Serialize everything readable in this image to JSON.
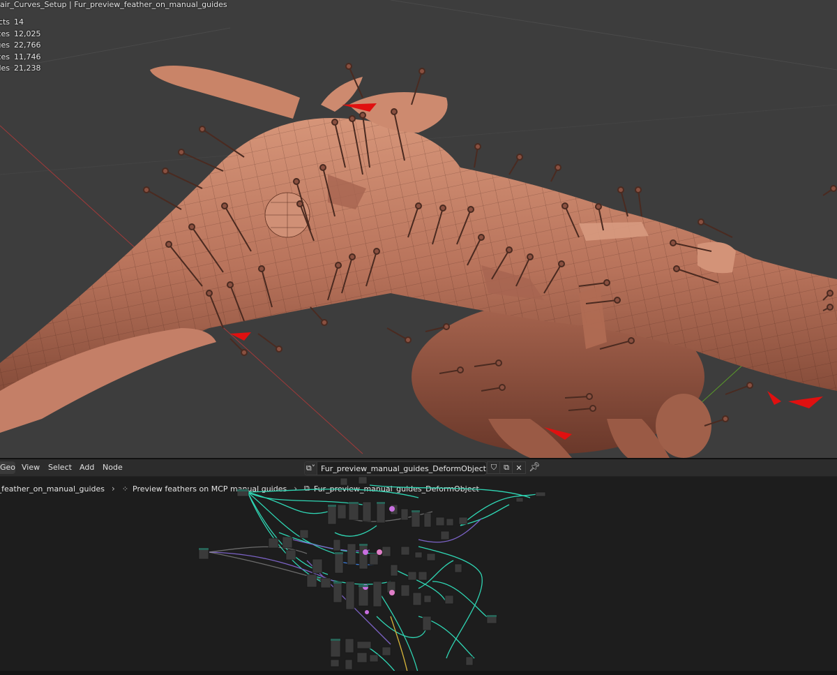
{
  "viewport": {
    "overlay_title": "air_Curves_Setup | Fur_preview_feather_on_manual_guides",
    "stats": [
      {
        "label": "Objects",
        "value": "14"
      },
      {
        "label": "Vertices",
        "value": "12,025"
      },
      {
        "label": "Edges",
        "value": "22,766"
      },
      {
        "label": "Faces",
        "value": "11,746"
      },
      {
        "label": "Triangles",
        "value": "21,238"
      }
    ],
    "colors": {
      "background": "#3d3d3d",
      "mesh": "#c7826a",
      "accent_red": "#e01010"
    }
  },
  "node_editor": {
    "editor_type_label": "Geometry Node Editor",
    "menus": [
      {
        "label": "View"
      },
      {
        "label": "Select"
      },
      {
        "label": "Add"
      },
      {
        "label": "Node"
      }
    ],
    "node_tree_name": "Fur_preview_manual_guides_DeformObject",
    "breadcrumb": [
      {
        "label": "Fur_preview_feather_on_manual_guides",
        "icon": "object-icon"
      },
      {
        "label": "Preview feathers on MCP manual guides",
        "icon": "modifier-nodes-icon"
      },
      {
        "label": "Fur_preview_manual_guides_DeformObject",
        "icon": "node-tree-icon"
      }
    ],
    "colors": {
      "link_teal": "#2fd6b4",
      "link_purple": "#7c63c7",
      "link_yellow": "#d6b43a",
      "node_body": "#3a3a3a"
    }
  }
}
